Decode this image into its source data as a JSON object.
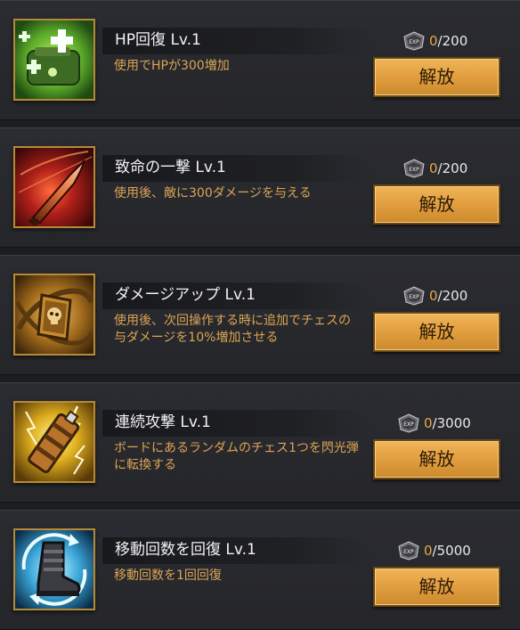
{
  "skills": [
    {
      "name": "HP回復 Lv.1",
      "description": "使用でHPが300増加",
      "exp_current": "0",
      "exp_required": "/200",
      "unlock_label": "解放",
      "icon": "green-medkit-icon"
    },
    {
      "name": "致命の一撃 Lv.1",
      "description": "使用後、敵に300ダメージを与える",
      "exp_current": "0",
      "exp_required": "/200",
      "unlock_label": "解放",
      "icon": "red-bullet-icon"
    },
    {
      "name": "ダメージアップ Lv.1",
      "description": "使用後、次回操作する時に追加でチェスの与ダメージを10%増加させる",
      "exp_current": "0",
      "exp_required": "/200",
      "unlock_label": "解放",
      "icon": "gold-skull-badge-icon"
    },
    {
      "name": "連続攻撃 Lv.1",
      "description": "ボードにあるランダムのチェス1つを閃光弾に転換する",
      "exp_current": "0",
      "exp_required": "/3000",
      "unlock_label": "解放",
      "icon": "lightning-grenade-icon"
    },
    {
      "name": "移動回数を回復 Lv.1",
      "description": "移動回数を1回回復",
      "exp_current": "0",
      "exp_required": "/5000",
      "unlock_label": "解放",
      "icon": "blue-boot-icon"
    }
  ],
  "exp_badge_label": "EXP",
  "colors": {
    "card_bg": "#2b2c31",
    "description_text": "#dca555",
    "button_gold": "#e3a041",
    "exp_current": "#e6a84a"
  }
}
